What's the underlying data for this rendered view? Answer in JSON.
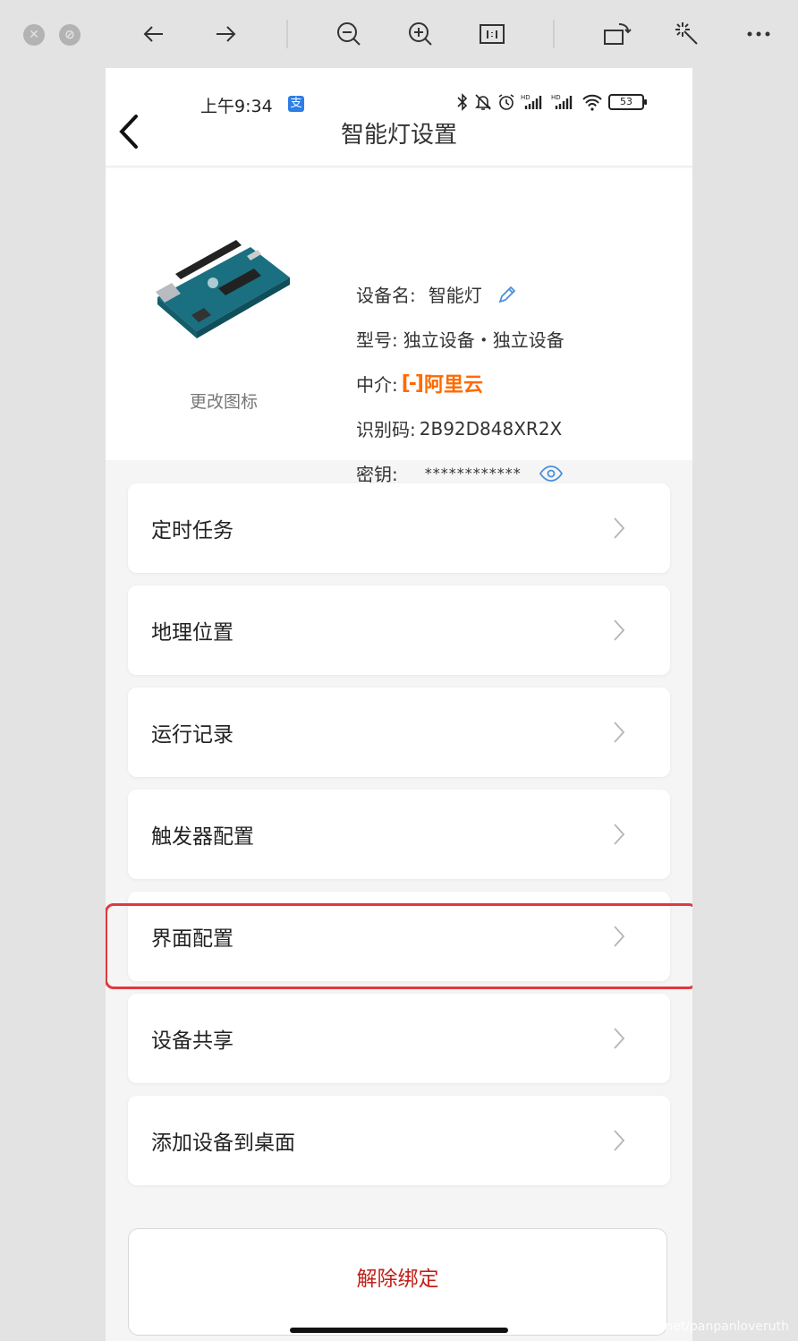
{
  "viewer": {
    "icons": [
      "close-icon",
      "minimize-icon",
      "arrow-left-icon",
      "arrow-right-icon",
      "zoom-out-icon",
      "zoom-in-icon",
      "actual-size-icon",
      "rotate-icon",
      "magic-wand-icon",
      "more-icon"
    ]
  },
  "status_bar": {
    "time": "上午9:34",
    "app_icon_glyph": "支",
    "battery": "53"
  },
  "header": {
    "title": "智能灯设置"
  },
  "device": {
    "change_icon_label": "更改图标",
    "name_label": "设备名:",
    "name_value": "智能灯",
    "model_label": "型号:",
    "model_value": "独立设备・独立设备",
    "broker_label": "中介:",
    "broker_value": "阿里云",
    "id_label": "识别码:",
    "id_value": "2B92D848XR2X",
    "key_label": "密钥:",
    "key_value": "************"
  },
  "menu": {
    "items": [
      {
        "label": "定时任务"
      },
      {
        "label": "地理位置"
      },
      {
        "label": "运行记录"
      },
      {
        "label": "触发器配置"
      },
      {
        "label": "界面配置"
      },
      {
        "label": "设备共享"
      },
      {
        "label": "添加设备到桌面"
      }
    ]
  },
  "unbind": {
    "label": "解除绑定"
  },
  "watermark": "https://blog.csdn.net/panpanloveruth",
  "colors": {
    "highlight": "#e0393f",
    "aliyun": "#ff6a00",
    "danger": "#c0221a",
    "accent": "#4a90d9"
  }
}
